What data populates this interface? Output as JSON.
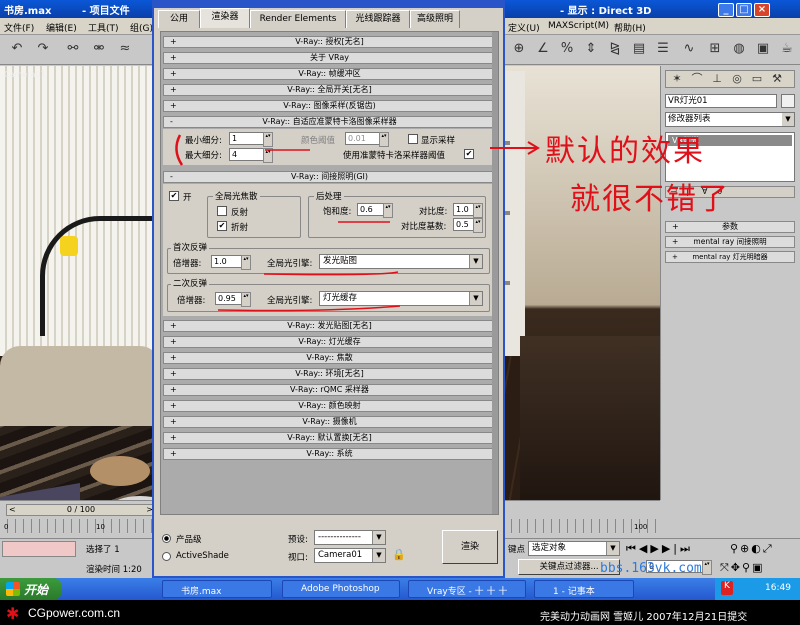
{
  "max": {
    "title_left": "书房.max",
    "title_mid": "- 项目文件",
    "title_right": "- 显示 : Direct 3D",
    "menu_left": [
      "文件(F)",
      "编辑(E)",
      "工具(T)",
      "组(G)"
    ],
    "menu_right": [
      "定义(U)",
      "MAXScript(M)",
      "帮助(H)"
    ],
    "viewport_label": "Camera01",
    "cmdpanel": {
      "object_name": "VR灯光01",
      "modifier_list": "修改器列表",
      "stack_item": "VR灯光",
      "rollouts": [
        "参数",
        "mental ray 间接照明",
        "mental ray 灯光明暗器"
      ]
    },
    "timeline": {
      "frame": "0 / 100",
      "ticks": [
        "0",
        "10",
        "100"
      ]
    },
    "status": {
      "selected": "选择了 1",
      "render_time": "渲染时间 1:20",
      "key_label": "键点",
      "key_select": "选定对象",
      "key_filter": "关键点过滤器...",
      "frame_value": "0",
      "watermark": "bbs.163vk.com"
    }
  },
  "dialog": {
    "tabs": [
      "公用",
      "渲染器",
      "Render Elements",
      "光线跟踪器",
      "高级照明"
    ],
    "active_tab": 1,
    "rollouts_top": [
      {
        "sign": "+",
        "label": "V-Ray:: 授权[无名]"
      },
      {
        "sign": "+",
        "label": "关于 VRay"
      },
      {
        "sign": "+",
        "label": "V-Ray:: 帧缓冲区"
      },
      {
        "sign": "+",
        "label": "V-Ray:: 全局开关[无名]"
      },
      {
        "sign": "+",
        "label": "V-Ray:: 图像采样(反锯齿)"
      },
      {
        "sign": "-",
        "label": "V-Ray:: 自适应准蒙特卡洛图像采样器"
      }
    ],
    "sampler": {
      "min_label": "最小细分:",
      "min_value": "1",
      "max_label": "最大细分:",
      "max_value": "4",
      "color_thresh_label": "颜色阈值",
      "color_thresh_value": "0.01",
      "show_samples_label": "显示采样",
      "use_qmc_label": "使用准蒙特卡洛采样器阈值",
      "use_qmc_check": "✔"
    },
    "gi_rollout": {
      "sign": "-",
      "label": "V-Ray:: 间接照明(GI)"
    },
    "gi": {
      "on_label": "开",
      "on_check": "✔",
      "caustics_title": "全局光焦散",
      "reflect_label": "反射",
      "refract_label": "折射",
      "refract_check": "✔",
      "post_title": "后处理",
      "saturation_label": "饱和度:",
      "saturation_value": "0.6",
      "contrast_label": "对比度:",
      "contrast_value": "1.0",
      "contrast_base_label": "对比度基数:",
      "contrast_base_value": "0.5",
      "primary_title": "首次反弹",
      "primary_mult_label": "倍增器:",
      "primary_mult_value": "1.0",
      "primary_engine_label": "全局光引擎:",
      "primary_engine_value": "发光贴图",
      "secondary_title": "二次反弹",
      "secondary_mult_label": "倍增器:",
      "secondary_mult_value": "0.95",
      "secondary_engine_label": "全局光引擎:",
      "secondary_engine_value": "灯光缓存"
    },
    "rollouts_bottom": [
      {
        "sign": "+",
        "label": "V-Ray:: 发光贴图[无名]"
      },
      {
        "sign": "+",
        "label": "V-Ray:: 灯光缓存"
      },
      {
        "sign": "+",
        "label": "V-Ray:: 焦散"
      },
      {
        "sign": "+",
        "label": "V-Ray:: 环境[无名]"
      },
      {
        "sign": "+",
        "label": "V-Ray:: rQMC 采样器"
      },
      {
        "sign": "+",
        "label": "V-Ray:: 颜色映射"
      },
      {
        "sign": "+",
        "label": "V-Ray:: 摄像机"
      },
      {
        "sign": "+",
        "label": "V-Ray:: 默认置换[无名]"
      },
      {
        "sign": "+",
        "label": "V-Ray:: 系统"
      }
    ],
    "bottom": {
      "production": "产品级",
      "activeshade": "ActiveShade",
      "preset_label": "预设:",
      "preset_value": "--------------",
      "viewport_label": "视口:",
      "viewport_value": "Camera01",
      "render_button": "渲染"
    }
  },
  "annotation": {
    "line1": "默认的效果",
    "line2": "就很不错了"
  },
  "taskbar": {
    "start": "开始",
    "tasks": [
      "书房.max",
      "Adobe Photoshop",
      "Vray专区 - 十 十 十",
      "1 - 记事本"
    ],
    "clock": "16:49"
  },
  "footer": {
    "left": "CGpower.com.cn",
    "right": "完美动力动画网 雪姬儿 2007年12月21日提交"
  },
  "colors": {
    "annotation": "#e0101a",
    "title_blue": "#0a4fcc",
    "taskbar_blue": "#2458cf"
  }
}
